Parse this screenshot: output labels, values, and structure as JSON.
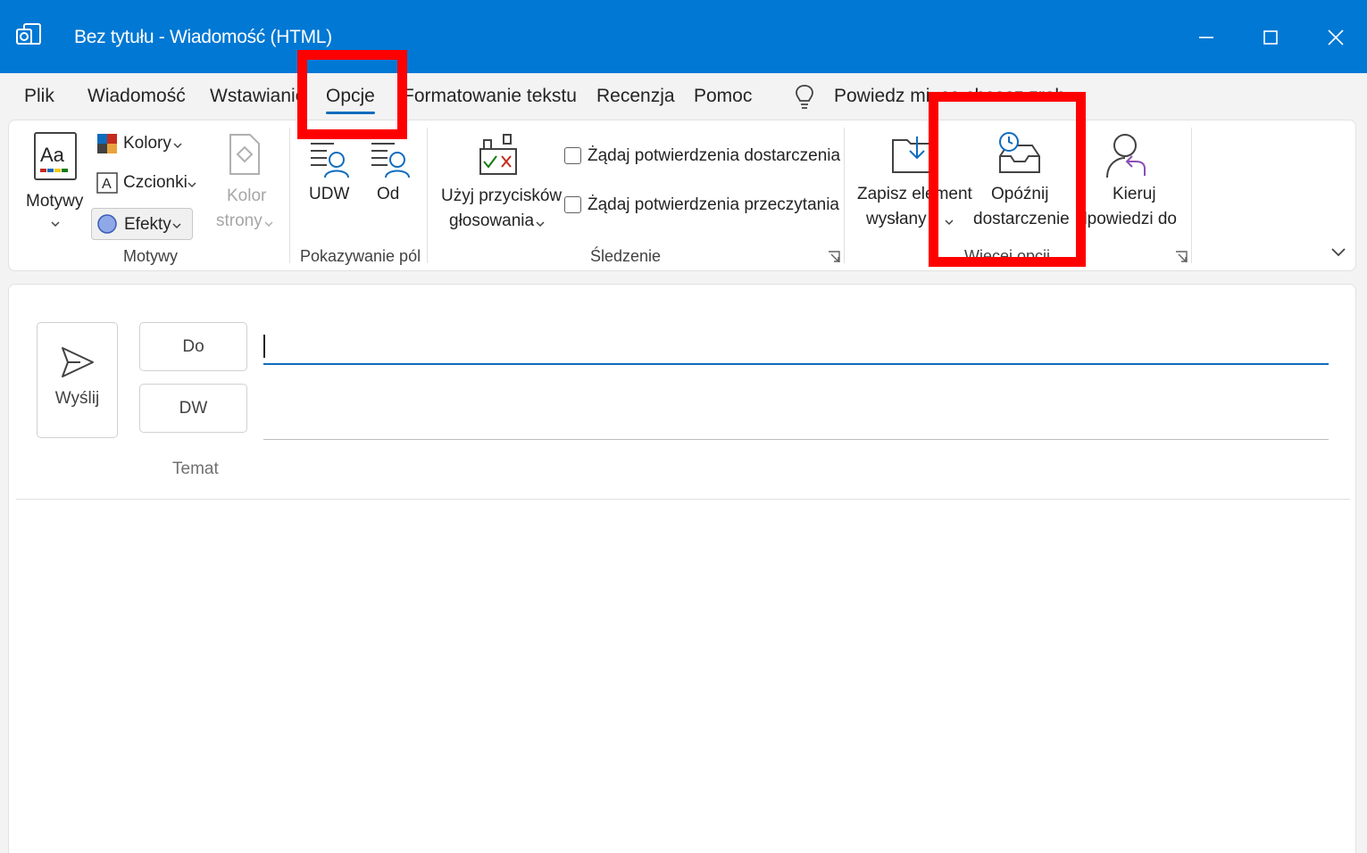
{
  "window": {
    "title": "Bez tytułu  -  Wiadomość (HTML)",
    "accent": "#0078d4"
  },
  "tabs": [
    {
      "label": "Plik"
    },
    {
      "label": "Wiadomość"
    },
    {
      "label": "Wstawianie"
    },
    {
      "label": "Opcje",
      "active": true
    },
    {
      "label": "Formatowanie tekstu"
    },
    {
      "label": "Recenzja"
    },
    {
      "label": "Pomoc"
    }
  ],
  "tell_me": {
    "text": "Powiedz mi, co chcesz zrobić"
  },
  "ribbon": {
    "motywy_group": {
      "themes": "Motywy",
      "colors": "Kolory",
      "fonts": "Czcionki",
      "effects": "Efekty",
      "page_color_line1": "Kolor",
      "page_color_line2": "strony",
      "label": "Motywy"
    },
    "fields_group": {
      "bcc": "UDW",
      "from": "Od",
      "label": "Pokazywanie pól"
    },
    "tracking_group": {
      "voting_line1": "Użyj przycisków",
      "voting_line2": "głosowania",
      "delivery_receipt": "Żądaj potwierdzenia dostarczenia",
      "read_receipt": "Żądaj potwierdzenia przeczytania",
      "label": "Śledzenie"
    },
    "more_group": {
      "save_sent_line1": "Zapisz element",
      "save_sent_line2": "wysłany",
      "delay_line1": "Opóźnij",
      "delay_line2": "dostarczenie",
      "direct_line1": "Kieruj",
      "direct_line2": "odpowiedzi do",
      "label": "Więcej opcji"
    }
  },
  "compose": {
    "send": "Wyślij",
    "to": "Do",
    "cc": "DW",
    "subject": "Temat"
  },
  "highlight_color": "#ff0000"
}
